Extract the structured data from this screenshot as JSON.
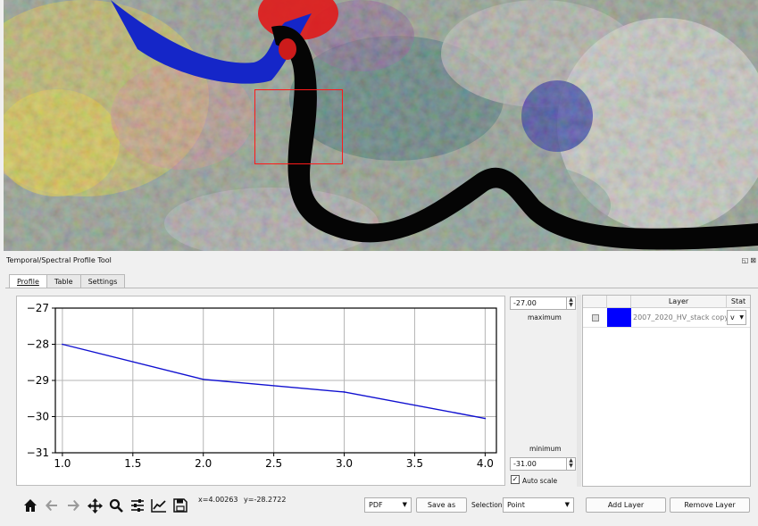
{
  "panel": {
    "title": "Temporal/Spectral Profile Tool",
    "controls": [
      "◱",
      "⊠"
    ]
  },
  "tabs": [
    {
      "label": "Profile",
      "active": true
    },
    {
      "label": "Table",
      "active": false
    },
    {
      "label": "Settings",
      "active": false
    }
  ],
  "chart_data": {
    "type": "line",
    "x": [
      1.0,
      2.0,
      3.0,
      4.0
    ],
    "series": [
      {
        "values": [
          -28.0,
          -28.97,
          -29.32,
          -30.05
        ],
        "color": "#1010d0"
      }
    ],
    "xlim": [
      0.95,
      4.08
    ],
    "ylim": [
      -31,
      -27
    ],
    "xticks": [
      "1.0",
      "1.5",
      "2.0",
      "2.5",
      "3.0",
      "3.5",
      "4.0"
    ],
    "xtick_values": [
      1.0,
      1.5,
      2.0,
      2.5,
      3.0,
      3.5,
      4.0
    ],
    "yticks": [
      "−27",
      "−28",
      "−29",
      "−30",
      "−31"
    ],
    "ytick_values": [
      -27,
      -28,
      -29,
      -30,
      -31
    ],
    "grid": true
  },
  "toolbar": {
    "icons": [
      "home-icon",
      "back-arrow-icon",
      "forward-arrow-icon",
      "pan-icon",
      "zoom-icon",
      "configure-icon",
      "edit-curve-icon",
      "save-icon"
    ],
    "x_readout": "x=4.00263",
    "y_readout": "y=-28.2722"
  },
  "scale": {
    "max_value": "-27.00",
    "max_label": "maximum",
    "min_label": "minimum",
    "min_value": "-31.00",
    "autoscale_label": "Auto scale",
    "autoscale_checked": true
  },
  "export": {
    "format": "PDF",
    "save_label": "Save as"
  },
  "selection": {
    "label": "Selection",
    "value": "Point"
  },
  "layers": {
    "headers": [
      "",
      "",
      "Layer",
      "Stat"
    ],
    "rows": [
      {
        "color": "#0000ff",
        "name": "2007_2020_HV_stack copy",
        "stat": "v"
      }
    ],
    "add_label": "Add Layer",
    "remove_label": "Remove Layer"
  }
}
